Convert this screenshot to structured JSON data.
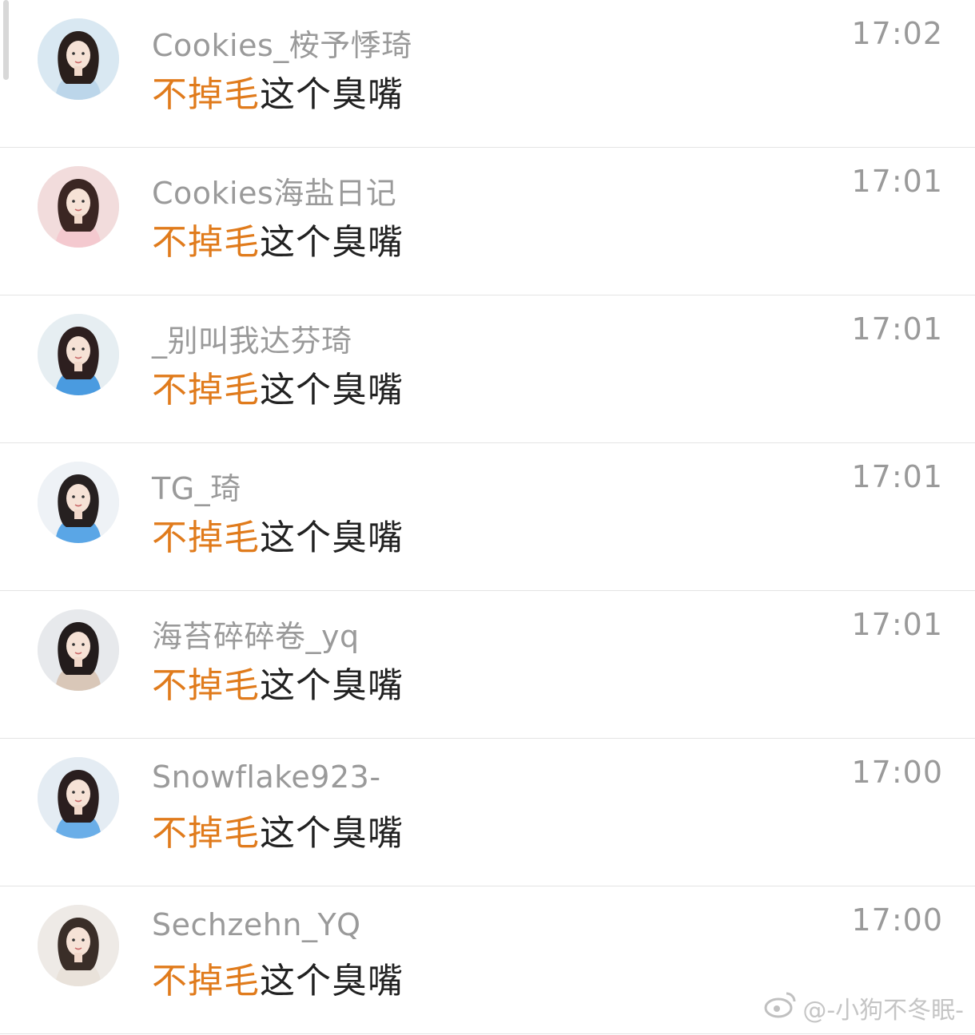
{
  "messages": [
    {
      "name": "Cookies_桉予悸琦",
      "highlight": "不掉毛",
      "text": "这个臭嘴",
      "time": "17:02",
      "avatar_icon": "user-avatar-icon",
      "avatar_bg": "#d9e8f2",
      "avatar_hair": "#2a1f1c",
      "avatar_cloth": "#bcd6ea"
    },
    {
      "name": "Cookies海盐日记",
      "highlight": "不掉毛",
      "text": "这个臭嘴",
      "time": "17:01",
      "avatar_icon": "user-avatar-icon",
      "avatar_bg": "#f2dcdc",
      "avatar_hair": "#3b2623",
      "avatar_cloth": "#f4c9cf"
    },
    {
      "name": "_别叫我达芬琦",
      "highlight": "不掉毛",
      "text": "这个臭嘴",
      "time": "17:01",
      "avatar_icon": "user-avatar-icon",
      "avatar_bg": "#e6eef2",
      "avatar_hair": "#2d1f1f",
      "avatar_cloth": "#4a9be0"
    },
    {
      "name": "TG_琦",
      "highlight": "不掉毛",
      "text": "这个臭嘴",
      "time": "17:01",
      "avatar_icon": "user-avatar-icon",
      "avatar_bg": "#eef2f6",
      "avatar_hair": "#262020",
      "avatar_cloth": "#5aa6e6"
    },
    {
      "name": "海苔碎碎卷_yq",
      "highlight": "不掉毛",
      "text": "这个臭嘴",
      "time": "17:01",
      "avatar_icon": "user-avatar-icon",
      "avatar_bg": "#e7e9ec",
      "avatar_hair": "#231c1c",
      "avatar_cloth": "#d9c7b8"
    },
    {
      "name": "Snowflake923-",
      "highlight": "不掉毛",
      "text": "这个臭嘴",
      "time": "17:00",
      "avatar_icon": "user-avatar-icon",
      "avatar_bg": "#e4ecf3",
      "avatar_hair": "#2a1e1e",
      "avatar_cloth": "#6aaee8"
    },
    {
      "name": "Sechzehn_YQ",
      "highlight": "不掉毛",
      "text": "这个臭嘴",
      "time": "17:00",
      "avatar_icon": "user-avatar-icon",
      "avatar_bg": "#eeeae6",
      "avatar_hair": "#3a2e28",
      "avatar_cloth": "#e9e2da"
    }
  ],
  "watermark": {
    "icon": "weibo-logo-icon",
    "text": "@-小狗不冬眠-"
  },
  "colors": {
    "highlight": "#e07b1c",
    "name": "#9a9a9a",
    "message": "#222222"
  }
}
